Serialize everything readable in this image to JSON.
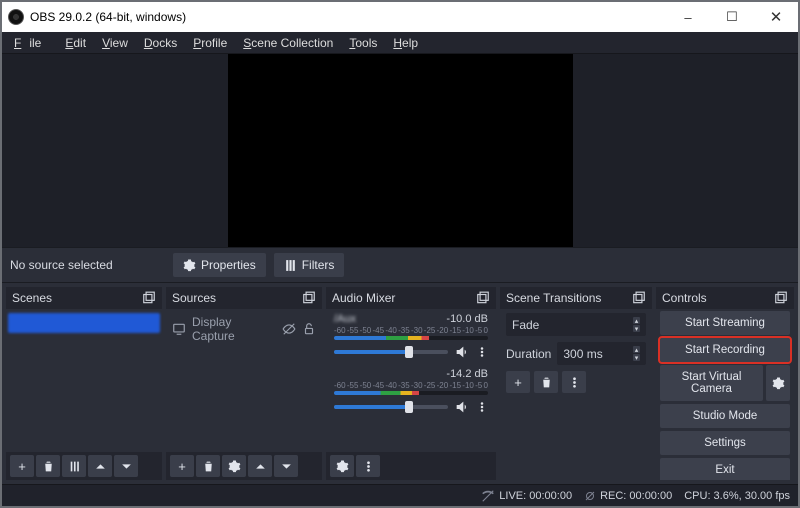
{
  "title": "OBS 29.0.2 (64-bit, windows)",
  "menus": [
    "File",
    "Edit",
    "View",
    "Docks",
    "Profile",
    "Scene Collection",
    "Tools",
    "Help"
  ],
  "props_row": {
    "no_source": "No source selected",
    "properties": "Properties",
    "filters": "Filters"
  },
  "panels": {
    "scenes": "Scenes",
    "sources": "Sources",
    "mixer": "Audio Mixer",
    "transitions": "Scene Transitions",
    "controls": "Controls"
  },
  "sources": {
    "display_capture": "Display Capture"
  },
  "mixer": {
    "ch1": {
      "name": "/Aux",
      "db": "-10.0 dB",
      "scale": [
        "-60",
        "-55",
        "-50",
        "-45",
        "-40",
        "-35",
        "-30",
        "-25",
        "-20",
        "-15",
        "-10",
        "-5",
        "0"
      ],
      "fill": 62,
      "slider": 66
    },
    "ch2": {
      "name": "",
      "db": "-14.2 dB",
      "scale": [
        "-60",
        "-55",
        "-50",
        "-45",
        "-40",
        "-35",
        "-30",
        "-25",
        "-20",
        "-15",
        "-10",
        "-5",
        "0"
      ],
      "fill": 55,
      "slider": 66
    }
  },
  "transitions": {
    "mode": "Fade",
    "duration_label": "Duration",
    "duration_value": "300 ms"
  },
  "controls": {
    "start_streaming": "Start Streaming",
    "start_recording": "Start Recording",
    "start_virtual_camera": "Start Virtual Camera",
    "studio_mode": "Studio Mode",
    "settings": "Settings",
    "exit": "Exit"
  },
  "statusbar": {
    "live": "LIVE: 00:00:00",
    "rec": "REC: 00:00:00",
    "cpu": "CPU: 3.6%, 30.00 fps"
  }
}
